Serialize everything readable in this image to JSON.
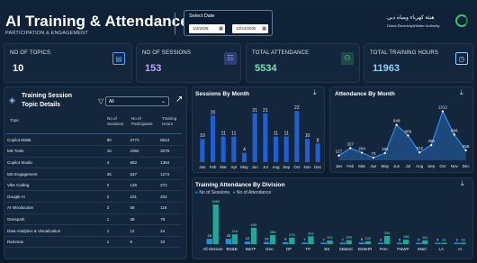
{
  "header": {
    "title": "AI Training & Attendance",
    "subtitle": "PARTICIPATION & ENGAGEMENT",
    "date_label": "Select Date",
    "start_date": "1/4/2025",
    "end_date": "12/24/2025",
    "logo_ar": "هيئة كهرباء ومياه دبي",
    "logo_en": "Dubai Electricity&Water Authority"
  },
  "kpis": [
    {
      "label": "NO OF TOPICS",
      "value": "10",
      "color": "#ffffff",
      "icon": "calendar-icon"
    },
    {
      "label": "NO OF SESSIONS",
      "value": "153",
      "color": "#b9a8f5",
      "icon": "people-icon"
    },
    {
      "label": "TOTAL ATTENDANCE",
      "value": "5534",
      "color": "#7fe0c0",
      "icon": "team-icon"
    },
    {
      "label": "TOTAL TRAINING HOURS",
      "value": "11963",
      "color": "#8fd3ff",
      "icon": "calendar-hours-icon"
    }
  ],
  "topics": {
    "title_line1": "Training Session",
    "title_line2": "Topic Details",
    "filter_value": "All",
    "columns": [
      "Topic",
      "No of Sessions",
      "No of Participants",
      "Training Hours"
    ],
    "rows": [
      [
        "Copilot M365",
        "90",
        "2772",
        "5544"
      ],
      [
        "MS Tools",
        "15",
        "1092",
        "3079"
      ],
      [
        "Copilot Studio",
        "4",
        "682",
        "1364"
      ],
      [
        "MS Engagement",
        "35",
        "637",
        "1274"
      ],
      [
        "Vibe Coding",
        "2",
        "136",
        "272"
      ],
      [
        "Google AI",
        "2",
        "101",
        "202"
      ],
      [
        "AI Introduction",
        "2",
        "58",
        "116"
      ],
      [
        "Genspark",
        "1",
        "39",
        "78"
      ],
      [
        "Data Analytics & Visualization",
        "1",
        "12",
        "24"
      ],
      [
        "Rammas",
        "1",
        "5",
        "10"
      ]
    ]
  },
  "chart_data": [
    {
      "type": "bar",
      "title": "Sessions By Month",
      "categories": [
        "Jan",
        "Feb",
        "Mar",
        "Apr",
        "May",
        "Jun",
        "Jul",
        "Aug",
        "Sep",
        "Oct",
        "Nov",
        "Dec"
      ],
      "values": [
        10,
        20,
        11,
        11,
        4,
        21,
        21,
        11,
        11,
        22,
        10,
        8
      ],
      "color": "#1f5fd1"
    },
    {
      "type": "area",
      "title": "Attendance By Month",
      "categories": [
        "Jan",
        "Feb",
        "Mar",
        "Apr",
        "May",
        "Jun",
        "Jul",
        "Aug",
        "Sep",
        "Oct",
        "Nov",
        "Dec"
      ],
      "values": [
        127,
        327,
        204,
        73,
        192,
        949,
        666,
        212,
        406,
        1312,
        689,
        266
      ],
      "color": "#2f8cf0"
    },
    {
      "type": "bar",
      "title": "Training Attendance By Division",
      "legend": "top-left",
      "categories": [
        "All Division",
        "BD&B",
        "B&TF",
        "Gen.",
        "DP",
        "TP",
        "BS",
        "SB&SC",
        "BS&HR",
        "Fem.",
        "P&WP",
        "W&C",
        "LA",
        "IA"
      ],
      "series": [
        {
          "name": "No of Sessions",
          "color": "#1f8fe0",
          "values": [
            25,
            25,
            12,
            10,
            9,
            7,
            7,
            7,
            8,
            3,
            5,
            4,
            4,
            3
          ]
        },
        {
          "name": "No of Attendance",
          "color": "#1fa89a",
          "values": [
            1680,
            416,
            695,
            386,
            274,
            331,
            151,
            166,
            122,
            345,
            188,
            161,
            31,
            16
          ]
        }
      ]
    }
  ]
}
